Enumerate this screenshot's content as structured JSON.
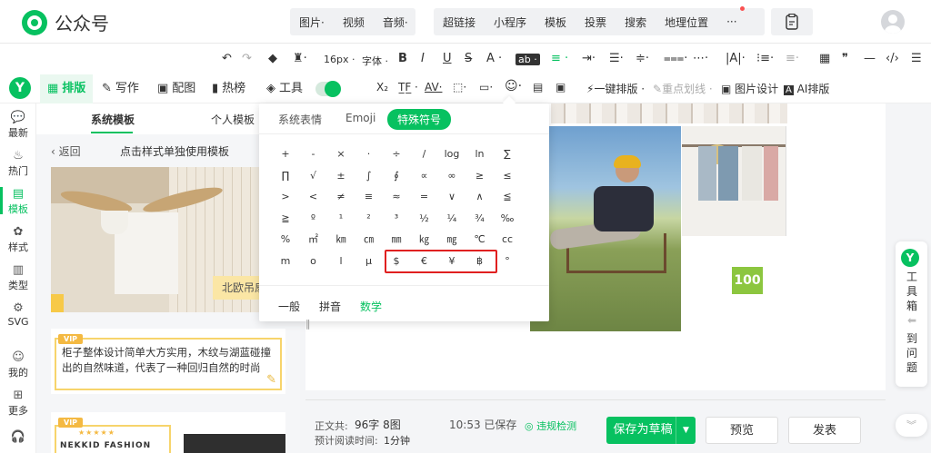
{
  "header": {
    "app_name": "公众号",
    "media_group": [
      "图片·",
      "视频",
      "音频·"
    ],
    "insert_group": [
      "超链接",
      "小程序",
      "模板",
      "投票",
      "搜索",
      "地理位置",
      "···"
    ]
  },
  "format_toolbar": {
    "undo": "↶",
    "redo": "↷",
    "font_size": "16px ·",
    "font_family": "字体 ·",
    "bold": "B",
    "italic": "I",
    "underline": "U",
    "strike": "S",
    "font_color": "A ·",
    "bg_color": "ab ·",
    "align": "≡ ·",
    "quote": "❞",
    "dash": "—",
    "code": "‹/›"
  },
  "toolbar2": {
    "tabs": [
      {
        "label": "排版",
        "icon": "layout-icon"
      },
      {
        "label": "写作",
        "icon": "pen-icon"
      },
      {
        "label": "配图",
        "icon": "image-icon"
      },
      {
        "label": "热榜",
        "icon": "bookmark-icon"
      },
      {
        "label": "工具",
        "icon": "cube-icon"
      }
    ],
    "yi_layout": "一键排版 ·",
    "highlight": "重点划线 ·",
    "image_design": "图片设计",
    "ai_layout": "AI排版",
    "ai_prefix": "A"
  },
  "rail": [
    {
      "label": "最新",
      "icon": "💬"
    },
    {
      "label": "热门",
      "icon": "♨"
    },
    {
      "label": "模板",
      "icon": "▤"
    },
    {
      "label": "样式",
      "icon": "✿"
    },
    {
      "label": "类型",
      "icon": "▥"
    },
    {
      "label": "SVG",
      "icon": "⚙"
    },
    {
      "label": "我的",
      "icon": "☺"
    },
    {
      "label": "更多",
      "icon": "⊞"
    },
    {
      "label": "",
      "icon": "🎧"
    }
  ],
  "template_panel": {
    "tabs": [
      "系统模板",
      "个人模板"
    ],
    "back": "返回",
    "hint": "点击样式单独使用模板",
    "card1_tag": "北欧吊扇",
    "vip": "VIP",
    "card2_text": "柜子整体设计简单大方实用，木纹与湖蓝碰撞出的自然味道，代表了一种回归自然的时尚",
    "card3_brand": "NEKKID FASHION",
    "card3_stars": "★★★★★"
  },
  "symbol_popup": {
    "tabs": [
      "系统表情",
      "Emoji",
      "特殊符号"
    ],
    "rows": [
      [
        "+",
        "-",
        "×",
        "·",
        "÷",
        "/",
        "log",
        "ln",
        "∑"
      ],
      [
        "∏",
        "√",
        "±",
        "∫",
        "∮",
        "∝",
        "∞",
        "≥",
        "≤"
      ],
      [
        ">",
        "<",
        "≠",
        "≡",
        "≈",
        "=",
        "∨",
        "∧",
        "≦"
      ],
      [
        "≧",
        "º",
        "¹",
        "²",
        "³",
        "½",
        "¼",
        "¾",
        "‰"
      ],
      [
        "%",
        "㎡",
        "㎞",
        "㎝",
        "㎜",
        "㎏",
        "㎎",
        "℃",
        "cc"
      ],
      [
        "m",
        "o",
        "l",
        "μ",
        "$",
        "€",
        "¥",
        "฿",
        "°"
      ]
    ],
    "bottom_tabs": [
      "一般",
      "拼音",
      "数学"
    ]
  },
  "editor": {
    "badge_value": "100"
  },
  "toolbox": {
    "label": [
      "工",
      "具",
      "箱"
    ],
    "feedback": [
      "到",
      "问",
      "题"
    ],
    "logo": "Y"
  },
  "status": {
    "body_label": "正文共:",
    "body_value": "96字 8图",
    "read_label": "预计阅读时间:",
    "read_value": "1分钟",
    "saved": "10:53  已保存",
    "check": "违规检测"
  },
  "buttons": {
    "save_draft": "保存为草稿",
    "preview": "预览",
    "publish": "发表"
  },
  "colors": {
    "accent": "#07c160",
    "highlight_border": "#e02020",
    "badge": "#8cc63f"
  }
}
